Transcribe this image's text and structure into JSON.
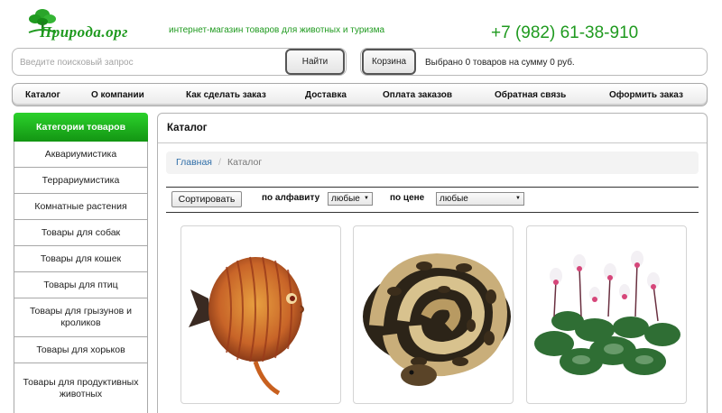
{
  "header": {
    "logo_text": "Природа.орг",
    "tagline": "интернет-магазин товаров для животных и туризма",
    "phone": "+7 (982) 61-38-910"
  },
  "search": {
    "placeholder": "Введите поисковый запрос",
    "button_label": "Найти"
  },
  "cart": {
    "button_label": "Корзина",
    "summary": "Выбрано 0 товаров на сумму 0 руб."
  },
  "nav": {
    "items": [
      {
        "label": "Каталог"
      },
      {
        "label": "О компании"
      },
      {
        "label": "Как сделать заказ"
      },
      {
        "label": "Доставка"
      },
      {
        "label": "Оплата заказов"
      },
      {
        "label": "Обратная связь"
      },
      {
        "label": "Оформить заказ"
      }
    ]
  },
  "sidebar": {
    "title": "Категории товаров",
    "items": [
      {
        "label": "Аквариумистика"
      },
      {
        "label": "Террариумистика"
      },
      {
        "label": "Комнатные растения"
      },
      {
        "label": "Товары для собак"
      },
      {
        "label": "Товары для кошек"
      },
      {
        "label": "Товары для птиц"
      },
      {
        "label": "Товары для грызунов и кроликов"
      },
      {
        "label": "Товары для хорьков"
      },
      {
        "label": "Товары для продуктивных животных"
      }
    ]
  },
  "main": {
    "title": "Каталог",
    "breadcrumb": {
      "home": "Главная",
      "separator": "/",
      "current": "Каталог"
    },
    "sort": {
      "button_label": "Сортировать",
      "alpha_label": "по алфавиту",
      "alpha_value": "любые",
      "price_label": "по цене",
      "price_value": "любые"
    },
    "products": [
      {
        "image": "discus-fish-image"
      },
      {
        "image": "python-snake-image"
      },
      {
        "image": "cyclamen-plant-image"
      }
    ]
  },
  "colors": {
    "brand_green": "#1f9a1f",
    "link_blue": "#2f6ea8"
  }
}
